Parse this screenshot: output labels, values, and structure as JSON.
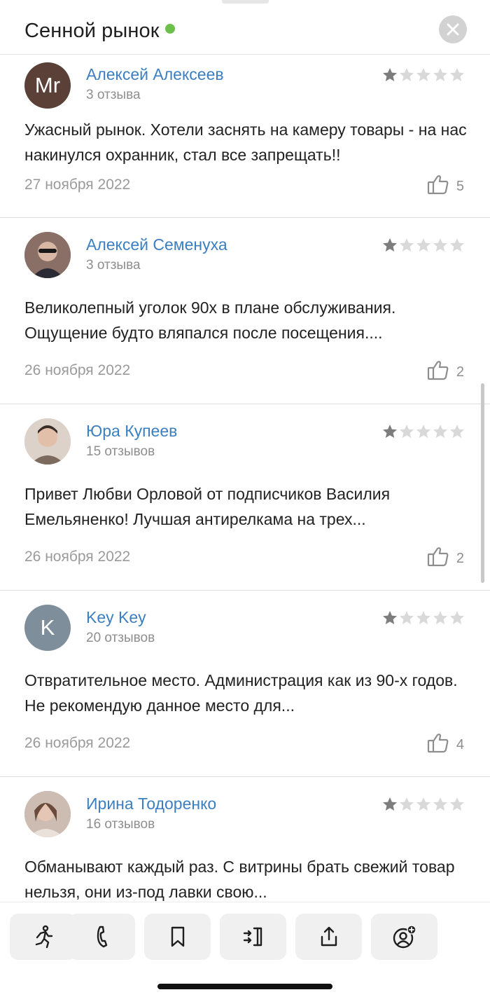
{
  "header": {
    "title": "Сенной рынок",
    "status_color": "#6cc04a",
    "close_icon": "close-icon"
  },
  "reviews": [
    {
      "author": "Алексей Алексеев",
      "review_count": "3 отзыва",
      "avatar_initials": "Mr",
      "avatar_color": "#5b4038",
      "rating": 1,
      "text": "Ужасный рынок. Хотели заснять на камеру товары - на нас накинулся охранник, стал все запрещать!!",
      "date": "27 ноября 2022",
      "likes": "5"
    },
    {
      "author": "Алексей Семенуха",
      "review_count": "3 отзыва",
      "avatar_initials": "",
      "avatar_color": "#8a6f66",
      "rating": 1,
      "text": "Великолепный уголок 90х в плане обслуживания. Ощущение будто вляпался после посещения....",
      "date": "26 ноября 2022",
      "likes": "2"
    },
    {
      "author": "Юра Купеев",
      "review_count": "15 отзывов",
      "avatar_initials": "",
      "avatar_color": "#c9b8ae",
      "rating": 1,
      "text": "Привет Любви Орловой от подписчиков Василия Емельяненко! Лучшая антирелкама на трех...",
      "date": "26 ноября 2022",
      "likes": "2"
    },
    {
      "author": "Key Key",
      "review_count": "20 отзывов",
      "avatar_initials": "K",
      "avatar_color": "#7e8e9b",
      "rating": 1,
      "text": "Отвратительное место. Администрация как из 90-х годов. Не рекомендую данное место для...",
      "date": "26 ноября 2022",
      "likes": "4"
    },
    {
      "author": "Ирина Тодоренко",
      "review_count": "16 отзывов",
      "avatar_initials": "",
      "avatar_color": "#b89e90",
      "rating": 1,
      "text": "Обманывают каждый раз. С витрины брать свежий товар нельзя, они из-под лавки свою...",
      "date": "",
      "likes": ""
    }
  ],
  "toolbar": [
    {
      "icon": "walking-person-icon"
    },
    {
      "icon": "phone-icon"
    },
    {
      "icon": "bookmark-icon"
    },
    {
      "icon": "route-icon"
    },
    {
      "icon": "share-icon"
    },
    {
      "icon": "add-person-icon"
    }
  ]
}
